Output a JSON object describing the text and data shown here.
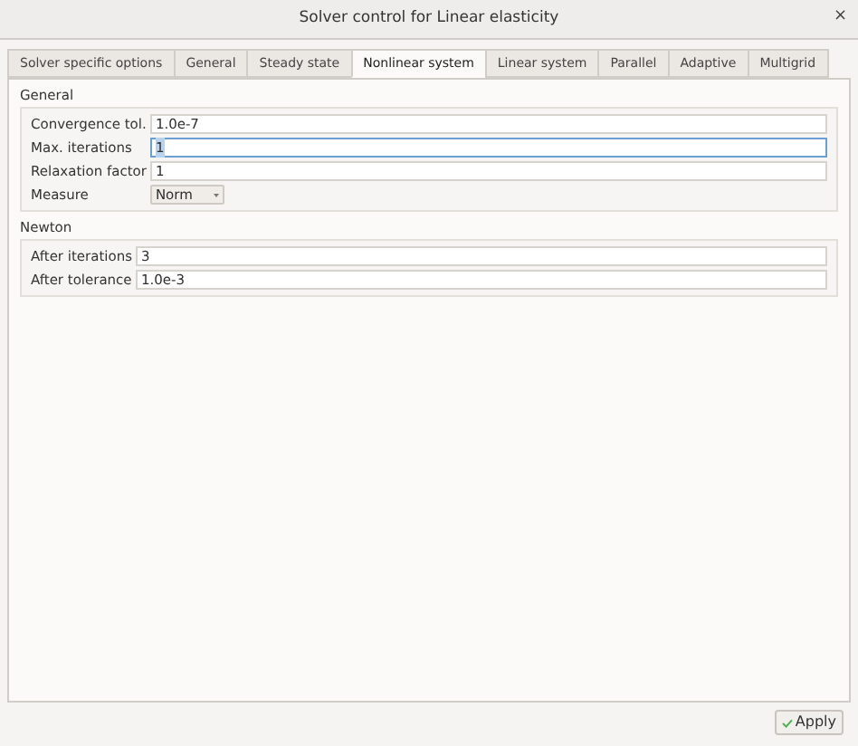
{
  "window": {
    "title": "Solver control for Linear elasticity",
    "close": "×"
  },
  "tabs": [
    {
      "label": "Solver specific options",
      "selected": false
    },
    {
      "label": "General",
      "selected": false
    },
    {
      "label": "Steady state",
      "selected": false
    },
    {
      "label": "Nonlinear system",
      "selected": true
    },
    {
      "label": "Linear system",
      "selected": false
    },
    {
      "label": "Parallel",
      "selected": false
    },
    {
      "label": "Adaptive",
      "selected": false
    },
    {
      "label": "Multigrid",
      "selected": false
    }
  ],
  "groups": [
    {
      "title": "General",
      "fields": [
        {
          "kind": "text",
          "label": "Convergence tol.",
          "value": "1.0e-7"
        },
        {
          "kind": "text",
          "label": "Max. iterations",
          "value": "1",
          "focused": true
        },
        {
          "kind": "text",
          "label": "Relaxation factor",
          "value": "1"
        },
        {
          "kind": "dropdown",
          "label": "Measure",
          "value": "Norm"
        }
      ]
    },
    {
      "title": "Newton",
      "fields": [
        {
          "kind": "text",
          "label": "After iterations",
          "value": "3"
        },
        {
          "kind": "text",
          "label": "After tolerance",
          "value": "1.0e-3"
        }
      ]
    }
  ],
  "apply_button": {
    "label": "Apply"
  }
}
